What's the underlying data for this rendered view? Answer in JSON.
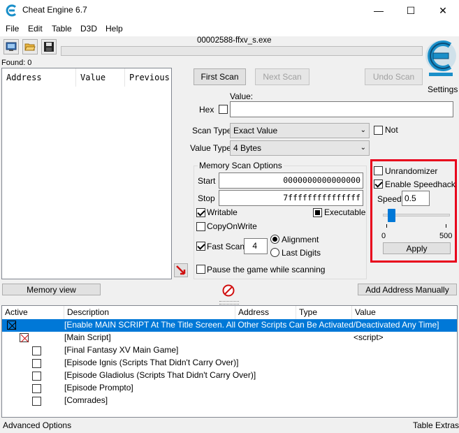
{
  "window": {
    "title": "Cheat Engine 6.7",
    "minimize_glyph": "—",
    "maximize_glyph": "☐",
    "close_glyph": "✕"
  },
  "menu": [
    "File",
    "Edit",
    "Table",
    "D3D",
    "Help"
  ],
  "process_name": "00002588-ffxv_s.exe",
  "found_label": "Found: 0",
  "address_list": {
    "columns": [
      "Address",
      "Value",
      "Previous"
    ]
  },
  "scan": {
    "first_scan": "First Scan",
    "next_scan": "Next Scan",
    "undo_scan": "Undo Scan",
    "settings_label": "Settings",
    "value_label": "Value:",
    "hex_label": "Hex",
    "scan_type_label": "Scan Type",
    "scan_type_value": "Exact Value",
    "not_label": "Not",
    "value_type_label": "Value Type",
    "value_type_value": "4 Bytes"
  },
  "memory_options": {
    "title": "Memory Scan Options",
    "start_label": "Start",
    "start_value": "0000000000000000",
    "stop_label": "Stop",
    "stop_value": "7fffffffffffffff",
    "writable_label": "Writable",
    "executable_label": "Executable",
    "copyonwrite_label": "CopyOnWrite",
    "fastscan_label": "Fast Scan",
    "fastscan_value": "4",
    "alignment_label": "Alignment",
    "lastdigits_label": "Last Digits",
    "pause_label": "Pause the game while scanning"
  },
  "speedhack": {
    "unrandomizer_label": "Unrandomizer",
    "enable_label": "Enable Speedhack",
    "speed_label": "Speed",
    "speed_value": "0.5",
    "slider_min": "0",
    "slider_max": "500",
    "slider_fraction": 0.04,
    "apply_label": "Apply"
  },
  "memory_view_button": "Memory view",
  "add_address_button": "Add Address Manually",
  "cheat_table": {
    "columns": [
      "Active",
      "Description",
      "Address",
      "Type",
      "Value"
    ],
    "rows": [
      {
        "description": "[Enable MAIN SCRIPT At The Title Screen. All Other Scripts Can Be Activated/Deactivated Any Time]",
        "value": "",
        "selected": true
      },
      {
        "description": "[Main Script]",
        "value": "<script>",
        "selected": false
      },
      {
        "description": "[Final Fantasy XV Main Game]",
        "value": "",
        "selected": false
      },
      {
        "description": "[Episode Ignis (Scripts That Didn't Carry Over)]",
        "value": "",
        "selected": false
      },
      {
        "description": "[Episode Gladiolus (Scripts That Didn't Carry Over)]",
        "value": "",
        "selected": false
      },
      {
        "description": "[Episode Prompto]",
        "value": "",
        "selected": false
      },
      {
        "description": "[Comrades]",
        "value": "",
        "selected": false
      }
    ]
  },
  "status": {
    "advanced_options": "Advanced Options",
    "table_extras": "Table Extras"
  },
  "colors": {
    "accent_selection": "#0078d7",
    "highlight_box": "#e8001c",
    "logo_blue": "#1a8fc9"
  }
}
